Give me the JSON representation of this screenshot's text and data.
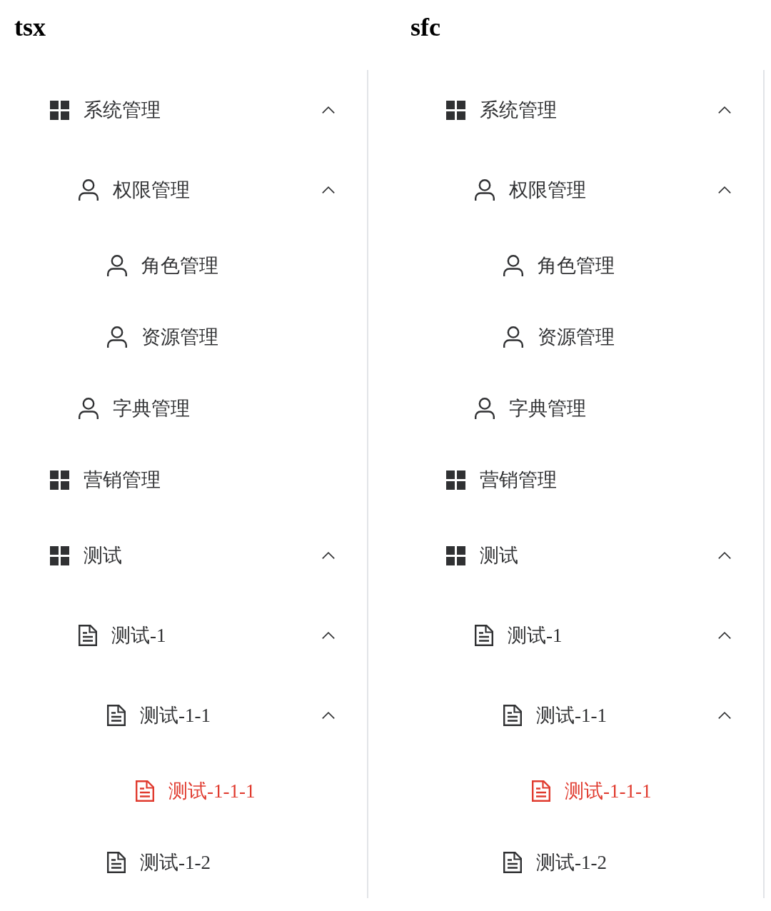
{
  "panels": [
    {
      "title": "tsx",
      "menu": [
        {
          "label": "系统管理",
          "kind": "module",
          "selected": false,
          "expanded": true,
          "children": [
            {
              "label": "权限管理",
              "kind": "user",
              "selected": false,
              "expanded": true,
              "children": [
                {
                  "label": "角色管理",
                  "kind": "user",
                  "selected": false
                },
                {
                  "label": "资源管理",
                  "kind": "user",
                  "selected": false
                }
              ]
            },
            {
              "label": "字典管理",
              "kind": "user",
              "selected": false
            }
          ]
        },
        {
          "label": "营销管理",
          "kind": "module",
          "selected": false
        },
        {
          "label": "测试",
          "kind": "module",
          "selected": false,
          "expanded": true,
          "children": [
            {
              "label": "测试-1",
              "kind": "document",
              "selected": false,
              "expanded": true,
              "children": [
                {
                  "label": "测试-1-1",
                  "kind": "document",
                  "selected": false,
                  "expanded": true,
                  "children": [
                    {
                      "label": "测试-1-1-1",
                      "kind": "document",
                      "selected": true
                    }
                  ]
                },
                {
                  "label": "测试-1-2",
                  "kind": "document",
                  "selected": false
                }
              ]
            }
          ]
        }
      ]
    },
    {
      "title": "sfc",
      "menu": [
        {
          "label": "系统管理",
          "kind": "module",
          "selected": false,
          "expanded": true,
          "children": [
            {
              "label": "权限管理",
              "kind": "user",
              "selected": false,
              "expanded": true,
              "children": [
                {
                  "label": "角色管理",
                  "kind": "user",
                  "selected": false
                },
                {
                  "label": "资源管理",
                  "kind": "user",
                  "selected": false
                }
              ]
            },
            {
              "label": "字典管理",
              "kind": "user",
              "selected": false
            }
          ]
        },
        {
          "label": "营销管理",
          "kind": "module",
          "selected": false
        },
        {
          "label": "测试",
          "kind": "module",
          "selected": false,
          "expanded": true,
          "children": [
            {
              "label": "测试-1",
              "kind": "document",
              "selected": false,
              "expanded": true,
              "children": [
                {
                  "label": "测试-1-1",
                  "kind": "document",
                  "selected": false,
                  "expanded": true,
                  "children": [
                    {
                      "label": "测试-1-1-1",
                      "kind": "document",
                      "selected": true
                    }
                  ]
                },
                {
                  "label": "测试-1-2",
                  "kind": "document",
                  "selected": false
                }
              ]
            }
          ]
        }
      ]
    }
  ]
}
